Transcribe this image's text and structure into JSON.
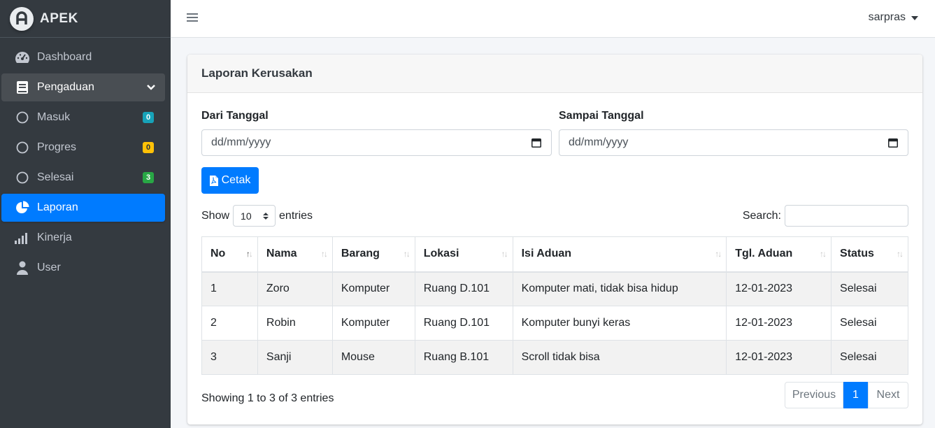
{
  "brand": {
    "name": "APEK"
  },
  "sidebar": {
    "items": [
      {
        "label": "Dashboard",
        "icon": "tachometer-icon"
      },
      {
        "label": "Pengaduan",
        "icon": "book-icon"
      },
      {
        "label": "Masuk",
        "icon": "circle-icon",
        "badge": "0"
      },
      {
        "label": "Progres",
        "icon": "circle-icon",
        "badge": "0"
      },
      {
        "label": "Selesai",
        "icon": "circle-icon",
        "badge": "3"
      },
      {
        "label": "Laporan",
        "icon": "pie-chart-icon"
      },
      {
        "label": "Kinerja",
        "icon": "signal-icon"
      },
      {
        "label": "User",
        "icon": "user-icon"
      }
    ]
  },
  "topbar": {
    "user": "sarpras"
  },
  "card": {
    "title": "Laporan Kerusakan",
    "from_label": "Dari Tanggal",
    "to_label": "Sampai Tanggal",
    "date_placeholder": "dd/mm/yyyy",
    "print_label": "Cetak"
  },
  "table_controls": {
    "show": "Show",
    "entries_value": "10",
    "entries": "entries",
    "search": "Search:"
  },
  "table": {
    "headers": [
      "No",
      "Nama",
      "Barang",
      "Lokasi",
      "Isi Aduan",
      "Tgl. Aduan",
      "Status"
    ],
    "rows": [
      [
        "1",
        "Zoro",
        "Komputer",
        "Ruang D.101",
        "Komputer mati, tidak bisa hidup",
        "12-01-2023",
        "Selesai"
      ],
      [
        "2",
        "Robin",
        "Komputer",
        "Ruang D.101",
        "Komputer bunyi keras",
        "12-01-2023",
        "Selesai"
      ],
      [
        "3",
        "Sanji",
        "Mouse",
        "Ruang B.101",
        "Scroll tidak bisa",
        "12-01-2023",
        "Selesai"
      ]
    ]
  },
  "footer": {
    "info": "Showing 1 to 3 of 3 entries",
    "previous": "Previous",
    "page": "1",
    "next": "Next"
  },
  "colors": {
    "sidebar": "#343a40",
    "primary": "#007bff"
  }
}
